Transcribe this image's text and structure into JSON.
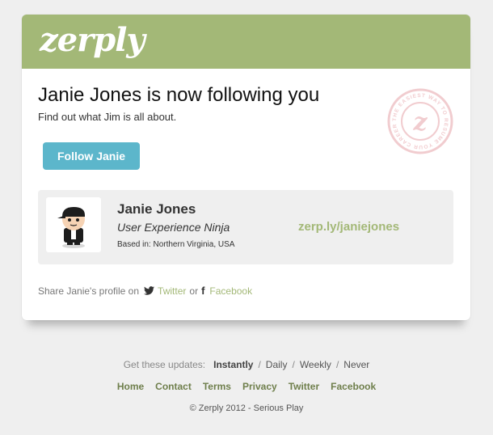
{
  "brand": {
    "logo": "zerply"
  },
  "email": {
    "headline": "Janie Jones is now following you",
    "subline": "Find out what Jim is all about.",
    "follow_button": "Follow Janie",
    "stamp_text": "THE EASIEST WAY TO RESUME YOUR CAREER"
  },
  "profile": {
    "name": "Janie Jones",
    "title": "User Experience Ninja",
    "location": "Based in: Northern Virginia, USA",
    "link": "zerp.ly/janiejones"
  },
  "share": {
    "prefix": "Share Janie's profile on",
    "twitter": "Twitter",
    "or": "or",
    "facebook": "Facebook"
  },
  "updates": {
    "label": "Get these updates:",
    "options": [
      "Instantly",
      "Daily",
      "Weekly",
      "Never"
    ],
    "selected": "Instantly",
    "separator": "/"
  },
  "footer": {
    "links": [
      "Home",
      "Contact",
      "Terms",
      "Privacy",
      "Twitter",
      "Facebook"
    ],
    "copyright": "©  Zerply 2012 - Serious Play"
  },
  "colors": {
    "banner": "#a3b877",
    "button": "#5cb6cb",
    "link_green": "#a3b877",
    "stamp": "#e6a3a8"
  }
}
